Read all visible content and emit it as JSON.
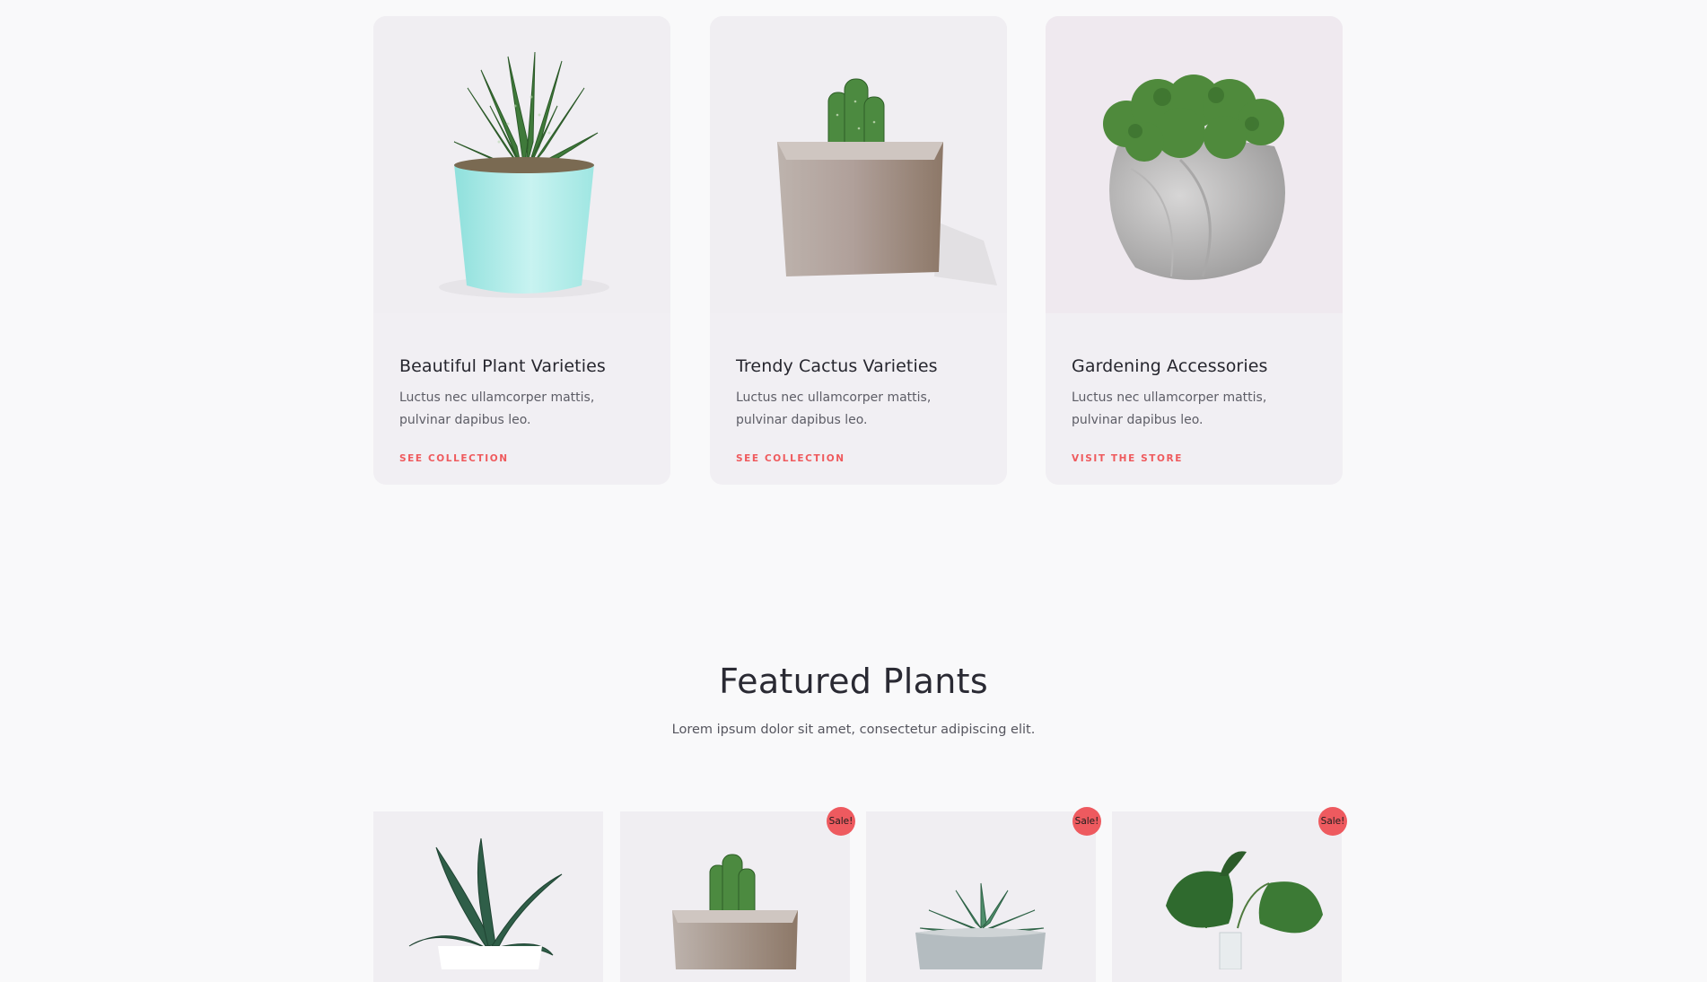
{
  "categories": [
    {
      "title": "Beautiful Plant Varieties",
      "desc": "Luctus nec ullamcorper mattis, pulvinar dapibus leo.",
      "link": "SEE COLLECTION"
    },
    {
      "title": "Trendy Cactus Varieties",
      "desc": "Luctus nec ullamcorper mattis, pulvinar dapibus leo.",
      "link": "SEE COLLECTION"
    },
    {
      "title": "Gardening Accessories",
      "desc": "Luctus nec ullamcorper mattis, pulvinar dapibus leo.",
      "link": "VISIT THE STORE"
    }
  ],
  "featured": {
    "title": "Featured Plants",
    "subtitle": "Lorem ipsum dolor sit amet, consectetur adipiscing elit."
  },
  "products": [
    {
      "image": "snake-plant-white-pot",
      "sale": ""
    },
    {
      "image": "cactus-square-pot",
      "sale": "Sale!"
    },
    {
      "image": "succulent-concrete-pot",
      "sale": "Sale!"
    },
    {
      "image": "anthurium-glass-vase",
      "sale": "Sale!"
    }
  ],
  "colors": {
    "accent": "#ef5a5d",
    "sale_badge": "#ee5a5f",
    "card_bg": "#f1eff3",
    "page_bg": "#f9f9fa"
  }
}
